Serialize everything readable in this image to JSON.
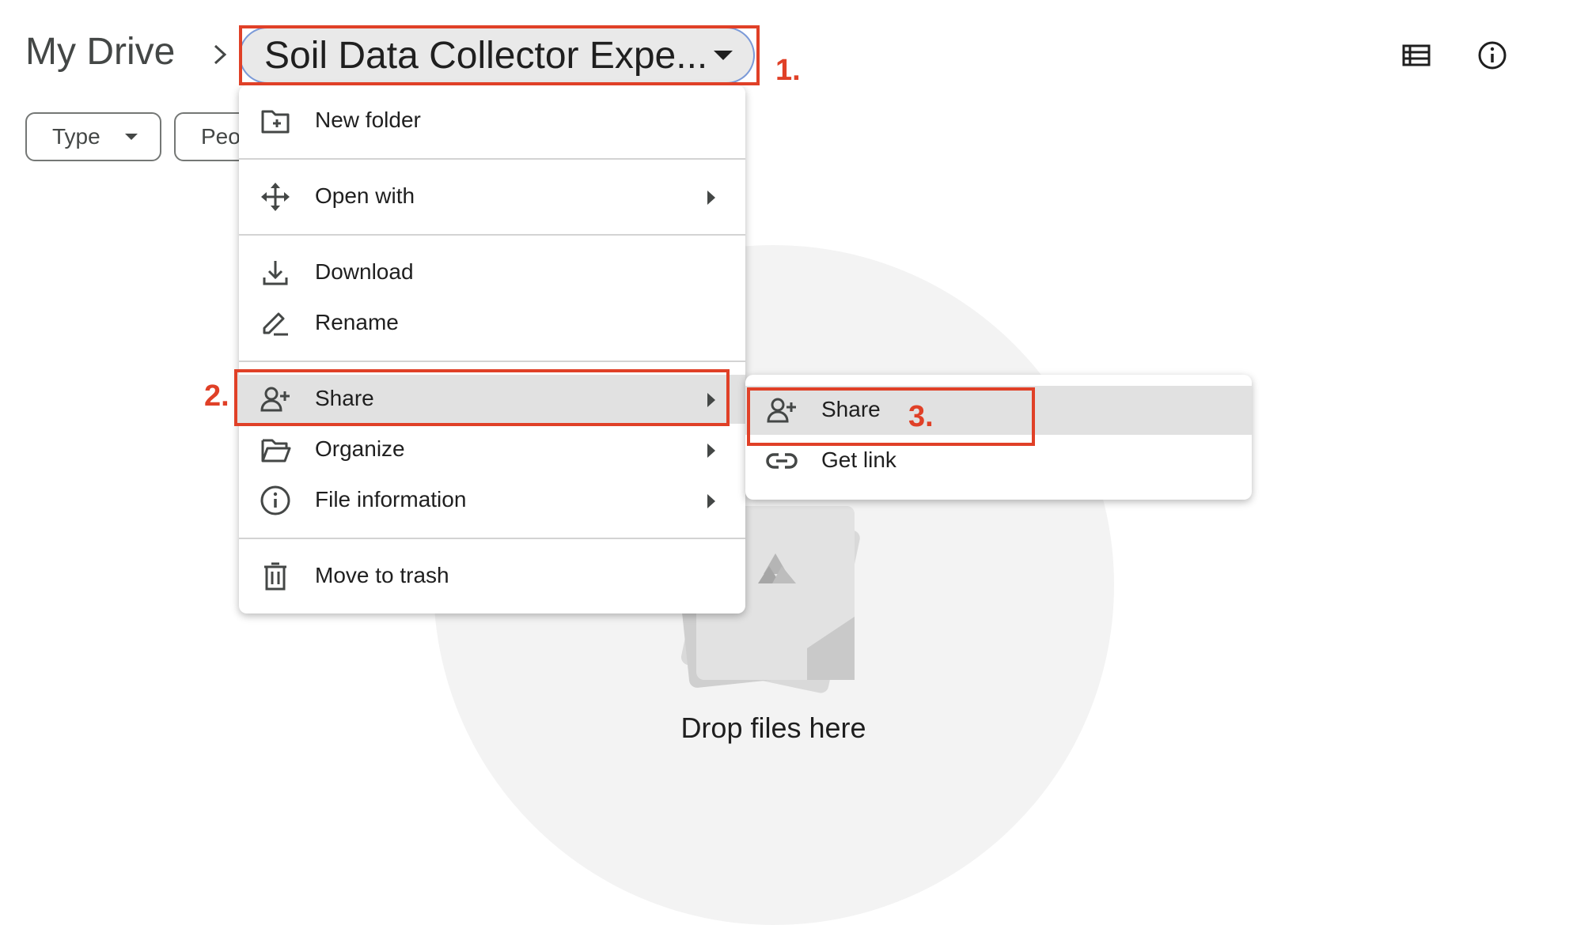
{
  "breadcrumb": {
    "root": "My Drive",
    "current": "Soil Data Collector Expe..."
  },
  "filters": [
    {
      "label": "Type"
    },
    {
      "label": "Peo"
    }
  ],
  "menu": {
    "items": [
      {
        "label": "New folder",
        "icon": "new-folder-icon"
      },
      {
        "label": "Open with",
        "icon": "move-arrows-icon"
      },
      {
        "label": "Download",
        "icon": "download-icon"
      },
      {
        "label": "Rename",
        "icon": "rename-pencil-icon"
      },
      {
        "label": "Share",
        "icon": "person-add-icon"
      },
      {
        "label": "Organize",
        "icon": "folder-open-icon"
      },
      {
        "label": "File information",
        "icon": "info-icon"
      },
      {
        "label": "Move to trash",
        "icon": "trash-icon"
      }
    ]
  },
  "submenu": {
    "items": [
      {
        "label": "Share",
        "icon": "person-add-icon"
      },
      {
        "label": "Get link",
        "icon": "link-icon"
      }
    ]
  },
  "empty_state": {
    "text": "Drop files here"
  },
  "annotations": {
    "step1": "1.",
    "step2": "2.",
    "step3": "3."
  },
  "colors": {
    "annotation": "#e04027",
    "highlight": "#e1e1e1",
    "breadcrumb_chip": "#e9e9e9"
  }
}
